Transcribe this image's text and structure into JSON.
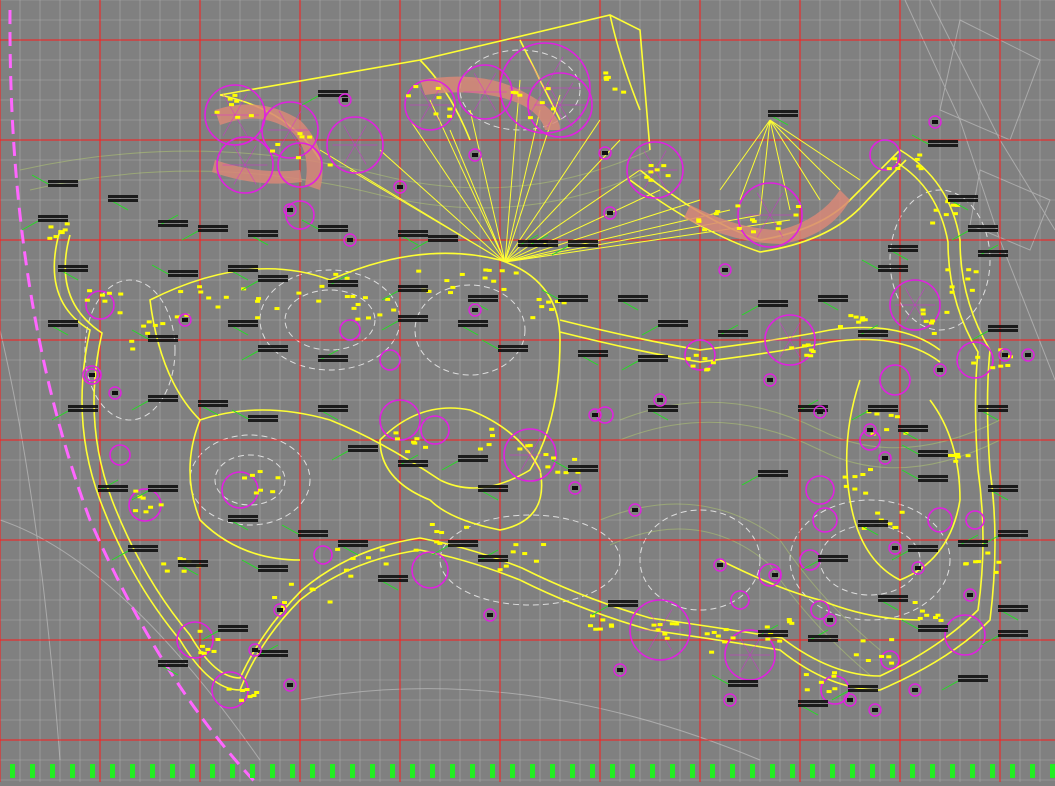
{
  "colors": {
    "background": "#808080",
    "grid_fine": "#c8c8c8",
    "grid_major": "#ff1a1a",
    "road_outline": "#ffff33",
    "setout_labels": "#ffff00",
    "tree_circles": "#e020e0",
    "leader_lines": "#20e020",
    "contours": "#ffffff",
    "hatch": "#b0c870",
    "boundary_dash": "#ff66ff",
    "bottom_ticks": "#22ee22"
  },
  "icons": {
    "tree_symbol": "circle-tree-icon",
    "label_badge": "tag-badge-icon"
  },
  "tag_labels": {
    "plaza": "广场",
    "pavilion": "亭子",
    "spot": "景点",
    "coordinate": "X=",
    "node": "节点"
  }
}
